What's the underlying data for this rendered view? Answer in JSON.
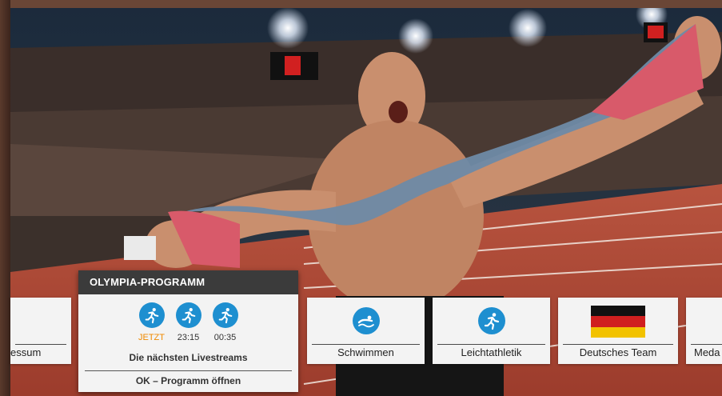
{
  "programm": {
    "title": "OLYMPIA-PROGRAMM",
    "slots": [
      {
        "time": "JETZT",
        "icon": "athletics-icon"
      },
      {
        "time": "23:15",
        "icon": "athletics-icon"
      },
      {
        "time": "00:35",
        "icon": "athletics-icon"
      }
    ],
    "next_label": "Die nächsten Livestreams",
    "open_label": "OK – Programm öffnen"
  },
  "tiles": {
    "impressum": "essum",
    "schwimmen": "Schwimmen",
    "leichtathletik": "Leichtathletik",
    "team": "Deutsches Team",
    "medaillen": "Meda"
  },
  "colors": {
    "accent": "#1e8fd0",
    "now": "#f08a00",
    "header": "#3b3b3b"
  }
}
